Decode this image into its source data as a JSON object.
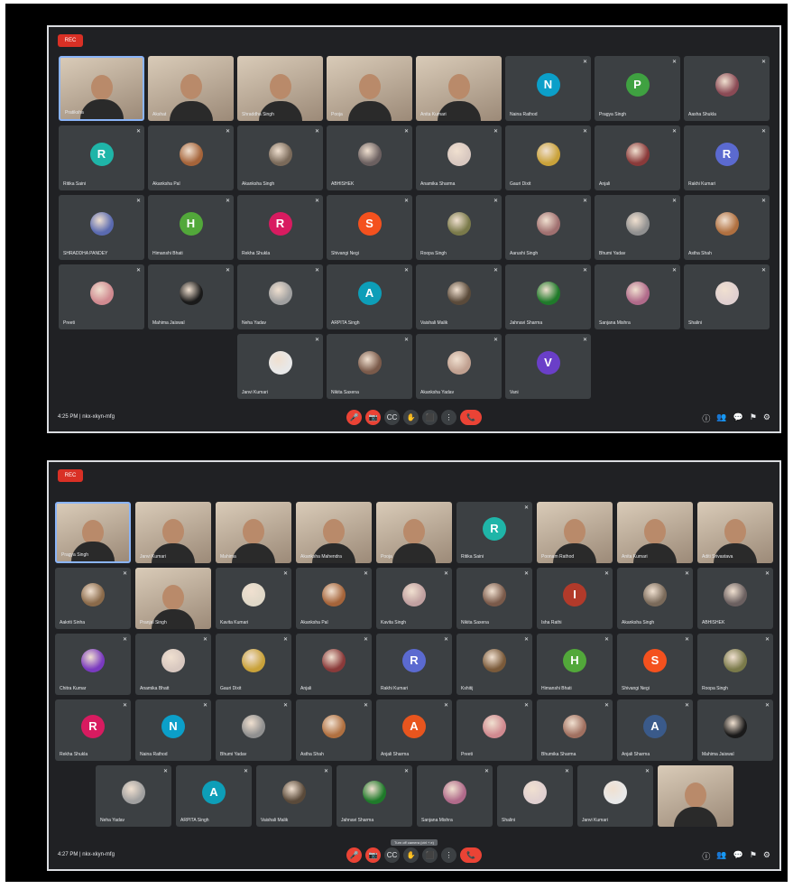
{
  "panels": [
    {
      "id": "meet-window-1",
      "rec_label": "REC",
      "meeting_info": "4:25 PM  |  nkx-xkyn-mfg",
      "controls": [
        "🎤",
        "📷",
        "CC",
        "✋",
        "⬛",
        "⋮",
        "📞"
      ],
      "side_controls": [
        "ⓘ",
        "👥",
        "💬",
        "⚑",
        "⚙"
      ],
      "rows": [
        [
          {
            "type": "video",
            "name": "Pratiksha",
            "pinned": true
          },
          {
            "type": "video",
            "name": "Akshat"
          },
          {
            "type": "video",
            "name": "Shraddha Singh"
          },
          {
            "type": "video",
            "name": "Pooja"
          },
          {
            "type": "video",
            "name": "Anita Kumari"
          },
          {
            "type": "letter",
            "letter": "N",
            "color": "#0b9fc9",
            "name": "Naina Rathod"
          },
          {
            "type": "letter",
            "letter": "P",
            "color": "#3fa141",
            "name": "Pragya Singh"
          },
          {
            "type": "photo",
            "color": "#8a4a55",
            "name": "Aasha Shukla"
          }
        ],
        [
          {
            "type": "letter",
            "letter": "R",
            "color": "#1fb5a8",
            "name": "Ritika Saini"
          },
          {
            "type": "photo",
            "color": "#a5643a",
            "name": "Akanksha Pal"
          },
          {
            "type": "photo",
            "color": "#7a6a5a",
            "name": "Akanksha Singh"
          },
          {
            "type": "photo",
            "color": "#6b6060",
            "name": "ABHISHEK"
          },
          {
            "type": "photo",
            "color": "#d8c8c0",
            "name": "Anamika Sharma"
          },
          {
            "type": "photo",
            "color": "#c9a23a",
            "name": "Gauri Dixit"
          },
          {
            "type": "photo",
            "color": "#8a3a3a",
            "name": "Anjali"
          },
          {
            "type": "letter",
            "letter": "R",
            "color": "#5b6ad0",
            "name": "Rakhi Kumari"
          }
        ],
        [
          {
            "type": "photo",
            "color": "#5a6ab0",
            "name": "SHRADDHA PANDEY"
          },
          {
            "type": "letter",
            "letter": "H",
            "color": "#52a83a",
            "name": "Himanshi Bhati"
          },
          {
            "type": "letter",
            "letter": "R",
            "color": "#d81b60",
            "name": "Rekha Shukla"
          },
          {
            "type": "letter",
            "letter": "S",
            "color": "#f4511e",
            "name": "Shivangi Negi"
          },
          {
            "type": "photo",
            "color": "#7a7a4a",
            "name": "Roopa Singh"
          },
          {
            "type": "photo",
            "color": "#a07070",
            "name": "Aarushi Singh"
          },
          {
            "type": "photo",
            "color": "#909090",
            "name": "Bhumi Yadav"
          },
          {
            "type": "photo",
            "color": "#b07040",
            "name": "Astha Shah"
          }
        ],
        [
          {
            "type": "photo",
            "color": "#d08a90",
            "name": "Preeti"
          },
          {
            "type": "photo",
            "color": "#1a1a1a",
            "name": "Mahima Jaiswal"
          },
          {
            "type": "photo",
            "color": "#a0a0a0",
            "name": "Neha Yadav"
          },
          {
            "type": "letter",
            "letter": "A",
            "color": "#0d9eb8",
            "name": "ARPITA Singh"
          },
          {
            "type": "photo",
            "color": "#5a4a3a",
            "name": "Vaishali Malik"
          },
          {
            "type": "photo",
            "color": "#1f7a2a",
            "name": "Jahnavi Sharma"
          },
          {
            "type": "photo",
            "color": "#b06a8a",
            "name": "Sanjana Mishra"
          },
          {
            "type": "photo",
            "color": "#e0d0d0",
            "name": "Shalini"
          }
        ],
        [
          {
            "type": "photo",
            "color": "#e8e8e8",
            "name": "Janvi Kumari"
          },
          {
            "type": "photo",
            "color": "#7a5a4a",
            "name": "Nikita Saxena"
          },
          {
            "type": "photo",
            "color": "#c0a090",
            "name": "Akanksha Yadav"
          },
          {
            "type": "letter",
            "letter": "V",
            "color": "#6a3fc8",
            "name": "Vani"
          }
        ]
      ]
    },
    {
      "id": "meet-window-2",
      "rec_label": "REC",
      "meeting_info": "4:27 PM  |  nkx-xkyn-mfg",
      "tooltip": "Turn off camera (ctrl + e)",
      "controls": [
        "🎤",
        "📷",
        "CC",
        "✋",
        "⬛",
        "⋮",
        "📞"
      ],
      "side_controls": [
        "ⓘ",
        "👥",
        "💬",
        "⚑",
        "⚙"
      ],
      "rows": [
        [
          {
            "type": "video",
            "name": "Pragya Singh",
            "pinned": true
          },
          {
            "type": "video",
            "name": "Janvi Kumari"
          },
          {
            "type": "video",
            "name": "Mahima"
          },
          {
            "type": "video",
            "name": "Akanksha Mahendra"
          },
          {
            "type": "video",
            "name": "Pooja"
          },
          {
            "type": "letter",
            "letter": "R",
            "color": "#1fb5a8",
            "name": "Ritika Saini"
          },
          {
            "type": "video",
            "name": "Poonam Rathod"
          },
          {
            "type": "video",
            "name": "Anita Kumari"
          },
          {
            "type": "video",
            "name": "Aditi Srivastava"
          }
        ],
        [
          {
            "type": "photo",
            "color": "#8a6a4a",
            "name": "Aakriti Sinha"
          },
          {
            "type": "video",
            "name": "Pranjal Singh"
          },
          {
            "type": "photo",
            "color": "#e0d8c8",
            "name": "Kavita Kumari"
          },
          {
            "type": "photo",
            "color": "#a5643a",
            "name": "Akanksha Pal"
          },
          {
            "type": "photo",
            "color": "#c0a0a0",
            "name": "Kavita Singh"
          },
          {
            "type": "photo",
            "color": "#7a5a4a",
            "name": "Nikita Saxena"
          },
          {
            "type": "letter",
            "letter": "I",
            "color": "#b23a2a",
            "name": "Isha Rathi"
          },
          {
            "type": "photo",
            "color": "#7a6a5a",
            "name": "Akanksha Singh"
          },
          {
            "type": "photo",
            "color": "#6b6060",
            "name": "ABHISHEK"
          }
        ],
        [
          {
            "type": "photo",
            "color": "#7a3ac0",
            "name": "Chitra Kumar"
          },
          {
            "type": "photo",
            "color": "#d8c8c0",
            "name": "Anamika Bhatt"
          },
          {
            "type": "photo",
            "color": "#c9a23a",
            "name": "Gauri Dixit"
          },
          {
            "type": "photo",
            "color": "#8a3a3a",
            "name": "Anjali"
          },
          {
            "type": "letter",
            "letter": "R",
            "color": "#5b6ad0",
            "name": "Rakhi Kumari"
          },
          {
            "type": "photo",
            "color": "#7a5a3a",
            "name": "Kshitij"
          },
          {
            "type": "letter",
            "letter": "H",
            "color": "#52a83a",
            "name": "Himanshi Bhati"
          },
          {
            "type": "letter",
            "letter": "S",
            "color": "#f4511e",
            "name": "Shivangi Negi"
          },
          {
            "type": "photo",
            "color": "#7a7a4a",
            "name": "Roopa Singh"
          }
        ],
        [
          {
            "type": "letter",
            "letter": "R",
            "color": "#d81b60",
            "name": "Rekha Shukla"
          },
          {
            "type": "letter",
            "letter": "N",
            "color": "#0b9fc9",
            "name": "Naina Rathod"
          },
          {
            "type": "photo",
            "color": "#909090",
            "name": "Bhumi Yadav"
          },
          {
            "type": "photo",
            "color": "#b07040",
            "name": "Astha Shah"
          },
          {
            "type": "letter",
            "letter": "A",
            "color": "#e8551e",
            "name": "Anjali Sharma"
          },
          {
            "type": "photo",
            "color": "#d08a90",
            "name": "Preeti"
          },
          {
            "type": "photo",
            "color": "#a07060",
            "name": "Bhumika Sharma"
          },
          {
            "type": "letter",
            "letter": "A",
            "color": "#3a5a8a",
            "name": "Anjali Sharma"
          },
          {
            "type": "photo",
            "color": "#1a1a1a",
            "name": "Mahima Jaiswal"
          }
        ],
        [
          {
            "type": "photo",
            "color": "#a0a0a0",
            "name": "Neha Yadav"
          },
          {
            "type": "letter",
            "letter": "A",
            "color": "#0d9eb8",
            "name": "ARPITA Singh"
          },
          {
            "type": "photo",
            "color": "#5a4a3a",
            "name": "Vaishali Malik"
          },
          {
            "type": "photo",
            "color": "#1f7a2a",
            "name": "Jahnavi Sharma"
          },
          {
            "type": "photo",
            "color": "#b06a8a",
            "name": "Sanjana Mishra"
          },
          {
            "type": "photo",
            "color": "#e0d0d0",
            "name": "Shalini"
          },
          {
            "type": "photo",
            "color": "#e8e8e8",
            "name": "Janvi Kumari"
          },
          {
            "type": "video",
            "name": ""
          }
        ]
      ]
    }
  ]
}
